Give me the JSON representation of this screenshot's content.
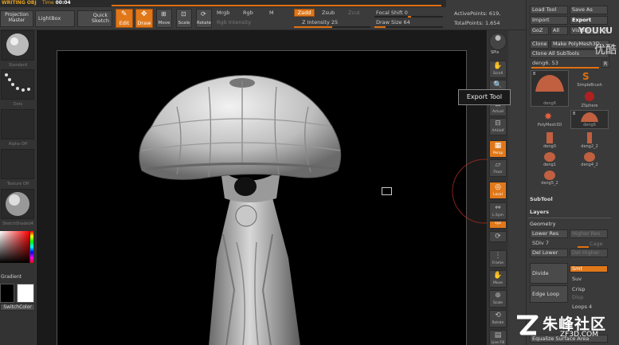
{
  "titlebar": {
    "app_title": "WRITING OBJ",
    "time_label": "Time",
    "time_value": "00:04"
  },
  "toolbar": {
    "projection_master": "Projection\nMaster",
    "lightbox": "LightBox",
    "quick_sketch": "Quick\nSketch",
    "edit": "Edit",
    "draw": "Draw",
    "move": "Move",
    "scale": "Scale",
    "rotate": "Rotate",
    "mrgb": "Mrgb",
    "rgb": "Rgb",
    "m": "M",
    "rgb_intensity": "Rgb Intensity",
    "zadd": "Zadd",
    "zsub": "Zsub",
    "zcut": "Zcut",
    "z_intensity": "Z Intensity 25",
    "focal_shift": "Focal Shift 0",
    "draw_size": "Draw Size 64",
    "active_points": "ActivePoints: 619,",
    "total_points": "TotalPoints: 1.654"
  },
  "left_panel": {
    "labels": [
      "Standard",
      "Dots",
      "Alpha Off",
      "Texture Off",
      "SketchShaded4",
      "Gradient",
      "SwitchColor"
    ]
  },
  "right_shelf": {
    "buttons": [
      "SPix",
      "Scroll",
      "Zoom",
      "Actual",
      "AAHalf",
      "Persp",
      "Floor",
      "Local",
      "L.Sym",
      "xyz",
      "",
      "Frame",
      "Move",
      "Scale",
      "Rotate",
      "Line Fill",
      ""
    ]
  },
  "tooltip": "Export Tool",
  "tool_tray": {
    "load_tool": "Load Tool",
    "save_as": "Save As",
    "import": "Import",
    "export": "Export",
    "goz": "GoZ",
    "all": "All",
    "visible": "Visible",
    "r": "R",
    "clone": "Clone",
    "make_polymesh": "Make PolyMesh3D",
    "clone_all_subtools": "Clone All SubTools",
    "current_tool": "deng6. 53",
    "tools": [
      "deng6",
      "SimpleBrush",
      "ZSphere",
      "PolyMesh3D",
      "deng6",
      "deng0",
      "deng2_2",
      "deng1",
      "deng4_2",
      "deng5_2"
    ],
    "tool_counts": [
      "8",
      "8"
    ],
    "subtool": "SubTool",
    "layers": "Layers",
    "geometry": "Geometry",
    "lower_res": "Lower Res",
    "higher_res": "Higher Res",
    "sdiv": "SDiv 7",
    "cage": "Cage",
    "del_lower": "Del Lower",
    "del_higher": "Del Higher",
    "divide": "Divide",
    "smt": "Smt",
    "suv": "Suv",
    "edge_loop": "Edge Loop",
    "crisp": "Crisp",
    "disp": "Disp",
    "loops": "Loops 4",
    "equalize": "Equalize Surface Area"
  },
  "watermark": {
    "top": "YOUKU",
    "top2": "优酷",
    "cn": "朱峰社区",
    "en": "ZF3D.COM"
  }
}
